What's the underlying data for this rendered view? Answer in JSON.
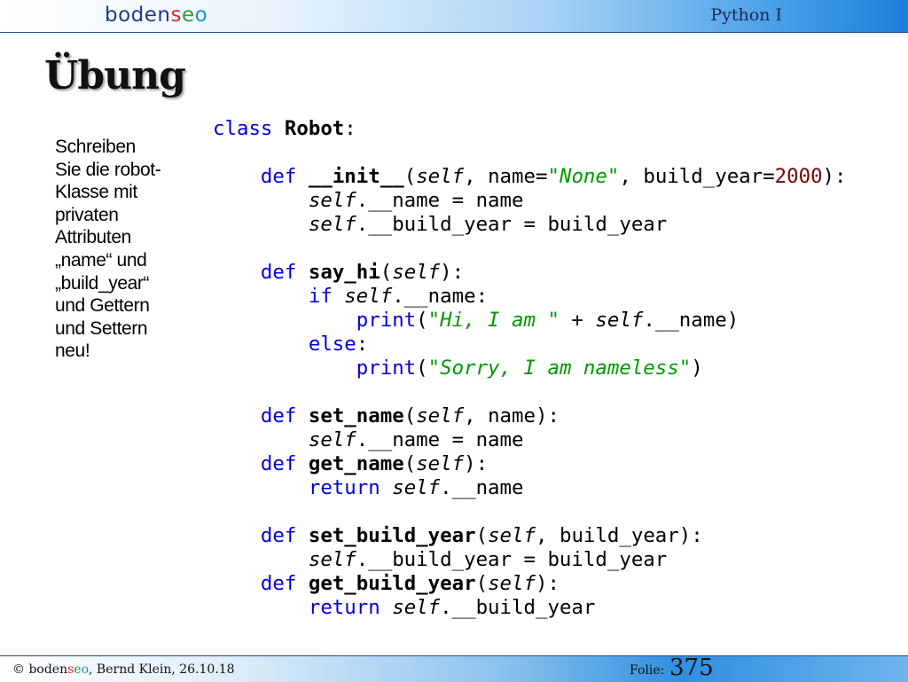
{
  "header": {
    "logo": {
      "part1": "boden",
      "part2": "s",
      "part3": "e",
      "part4": "o"
    },
    "course": "Python I"
  },
  "slide": {
    "title": "Übung",
    "task_text": "Schreiben\nSie die robot-\nKlasse mit\nprivaten\nAttributen\n„name“ und\n„build_year“\nund Gettern\nund Settern\nneu!"
  },
  "code": {
    "line1": {
      "kw": "class",
      "name": "Robot",
      "end": ":"
    },
    "init": {
      "kw": "def",
      "name": "__init__",
      "p1": "(",
      "self": "self",
      "p2": ", name=",
      "sq1": "\"",
      "str": "None",
      "sq2": "\"",
      "p3": ", build_year=",
      "num": "2000",
      "p4": "):"
    },
    "init_b1": {
      "self": "self",
      "rest": ".__name = name"
    },
    "init_b2": {
      "self": "self",
      "rest": ".__build_year = build_year"
    },
    "sayhi": {
      "kw": "def",
      "name": "say_hi",
      "p1": "(",
      "self": "self",
      "p2": "):"
    },
    "if": {
      "kw": "if",
      "self": "self",
      "rest": ".__name:"
    },
    "print1": {
      "bi": "print",
      "p1": "(",
      "sq1": "\"",
      "str": "Hi, I am ",
      "sq2": "\"",
      "p2": " + ",
      "self": "self",
      "rest": ".__name)"
    },
    "else": {
      "kw": "else",
      "rest": ":"
    },
    "print2": {
      "bi": "print",
      "p1": "(",
      "sq1": "\"",
      "str": "Sorry, I am nameless",
      "sq2": "\"",
      "p2": ")"
    },
    "setname": {
      "kw": "def",
      "name": "set_name",
      "p1": "(",
      "self": "self",
      "p2": ", name):"
    },
    "setname_b": {
      "self": "self",
      "rest": ".__name = name"
    },
    "getname": {
      "kw": "def",
      "name": "get_name",
      "p1": "(",
      "self": "self",
      "p2": "):"
    },
    "getname_b": {
      "kw": "return",
      "self": "self",
      "rest": ".__name"
    },
    "setby": {
      "kw": "def",
      "name": "set_build_year",
      "p1": "(",
      "self": "self",
      "p2": ", build_year):"
    },
    "setby_b": {
      "self": "self",
      "rest": ".__build_year = build_year"
    },
    "getby": {
      "kw": "def",
      "name": "get_build_year",
      "p1": "(",
      "self": "self",
      "p2": "):"
    },
    "getby_b": {
      "kw": "return",
      "self": "self",
      "rest": ".__build_year"
    }
  },
  "footer": {
    "copyright": "© ",
    "logo": {
      "part1": "boden",
      "part2": "s",
      "part3": "e",
      "part4": "o"
    },
    "author_date": ", Bernd Klein, 26.10.18",
    "folie_label": "Folie:",
    "folie_number": "375"
  }
}
